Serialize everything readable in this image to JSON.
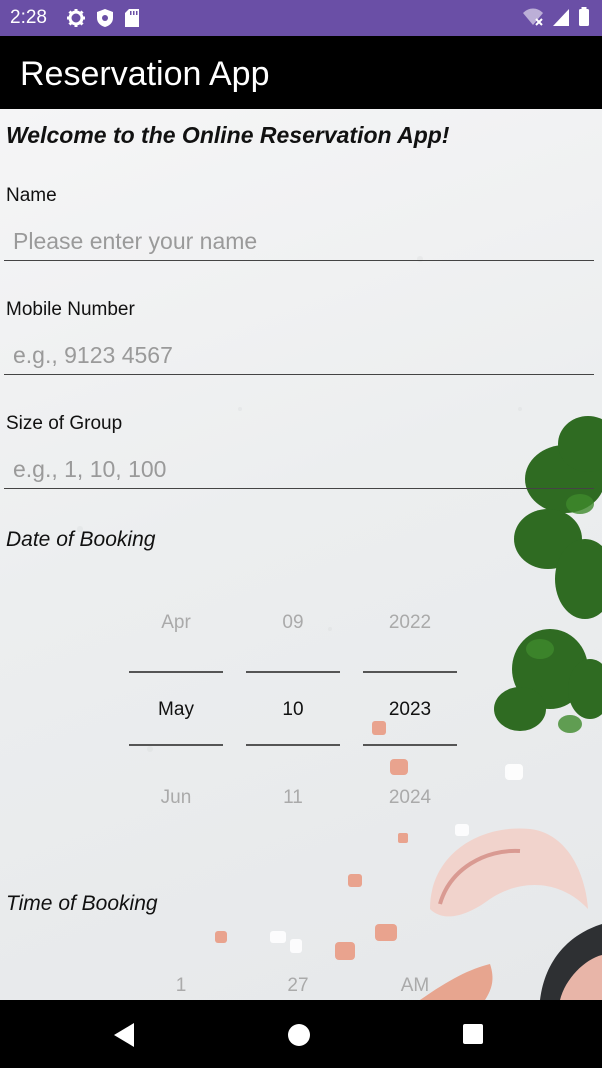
{
  "status_bar": {
    "time": "2:28",
    "icons_left": [
      "gear-icon",
      "shield-icon",
      "sd-card-icon"
    ],
    "icons_right": [
      "wifi-off-icon",
      "signal-icon",
      "battery-icon"
    ],
    "color": "#6a4fa6"
  },
  "app_bar": {
    "title": "Reservation App"
  },
  "form": {
    "welcome": "Welcome to the Online Reservation App!",
    "name": {
      "label": "Name",
      "placeholder": "Please enter your name",
      "value": ""
    },
    "mobile": {
      "label": "Mobile Number",
      "placeholder": "e.g., 9123 4567",
      "value": ""
    },
    "group": {
      "label": "Size of Group",
      "placeholder": "e.g., 1, 10, 100",
      "value": ""
    },
    "date": {
      "label": "Date of Booking",
      "month": {
        "prev": "Apr",
        "selected": "May",
        "next": "Jun"
      },
      "day": {
        "prev": "09",
        "selected": "10",
        "next": "11"
      },
      "year": {
        "prev": "2022",
        "selected": "2023",
        "next": "2024"
      }
    },
    "time": {
      "label": "Time of Booking",
      "hour": {
        "prev": "1"
      },
      "minute": {
        "prev": "27"
      },
      "ampm": {
        "prev": "AM"
      }
    }
  },
  "nav_bar": {
    "buttons": [
      "back-icon",
      "home-icon",
      "recents-icon"
    ]
  }
}
